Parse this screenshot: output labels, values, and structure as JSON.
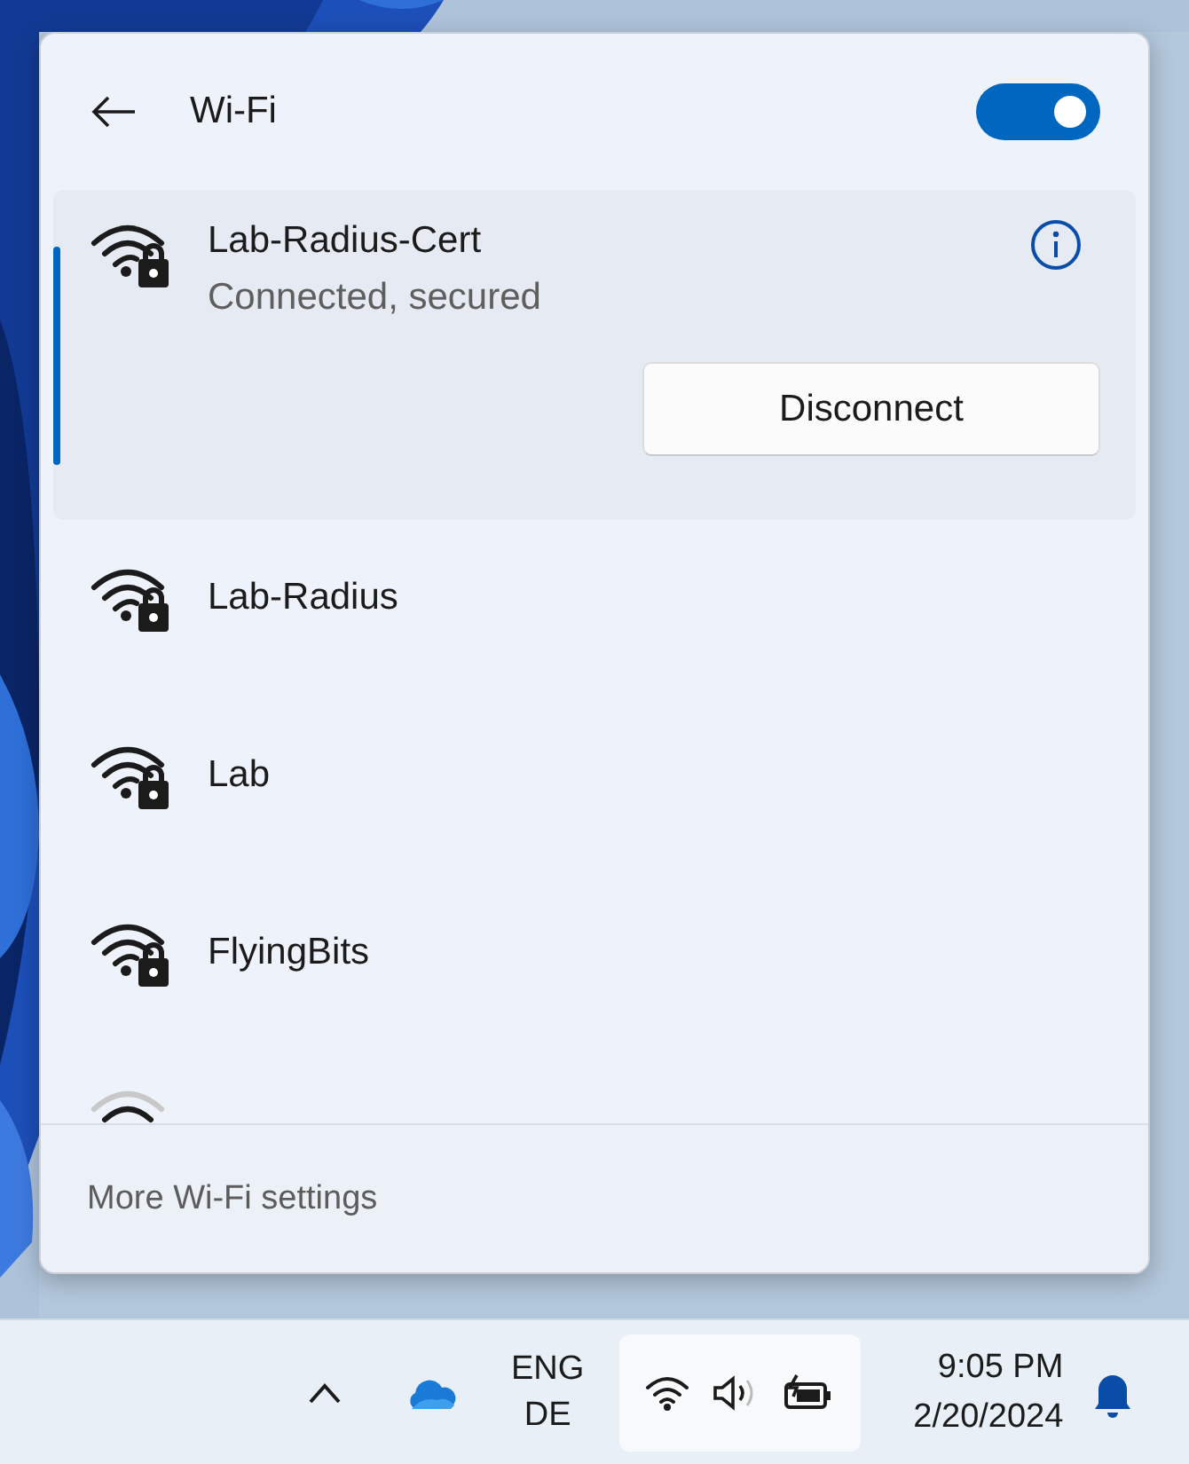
{
  "window": {
    "title": "Wi-Fi"
  },
  "wifi_toggle": {
    "on": true
  },
  "networks": [
    {
      "name": "Lab-Radius-Cert",
      "status": "Connected, secured",
      "secured": true,
      "selected": true,
      "action": "Disconnect"
    },
    {
      "name": "Lab-Radius",
      "secured": true,
      "selected": false
    },
    {
      "name": "Lab",
      "secured": true,
      "selected": false
    },
    {
      "name": "FlyingBits",
      "secured": true,
      "selected": false
    }
  ],
  "footer": {
    "link": "More Wi-Fi settings"
  },
  "taskbar": {
    "language": [
      "ENG",
      "DE"
    ],
    "time": "9:05 PM",
    "date": "2/20/2024"
  }
}
